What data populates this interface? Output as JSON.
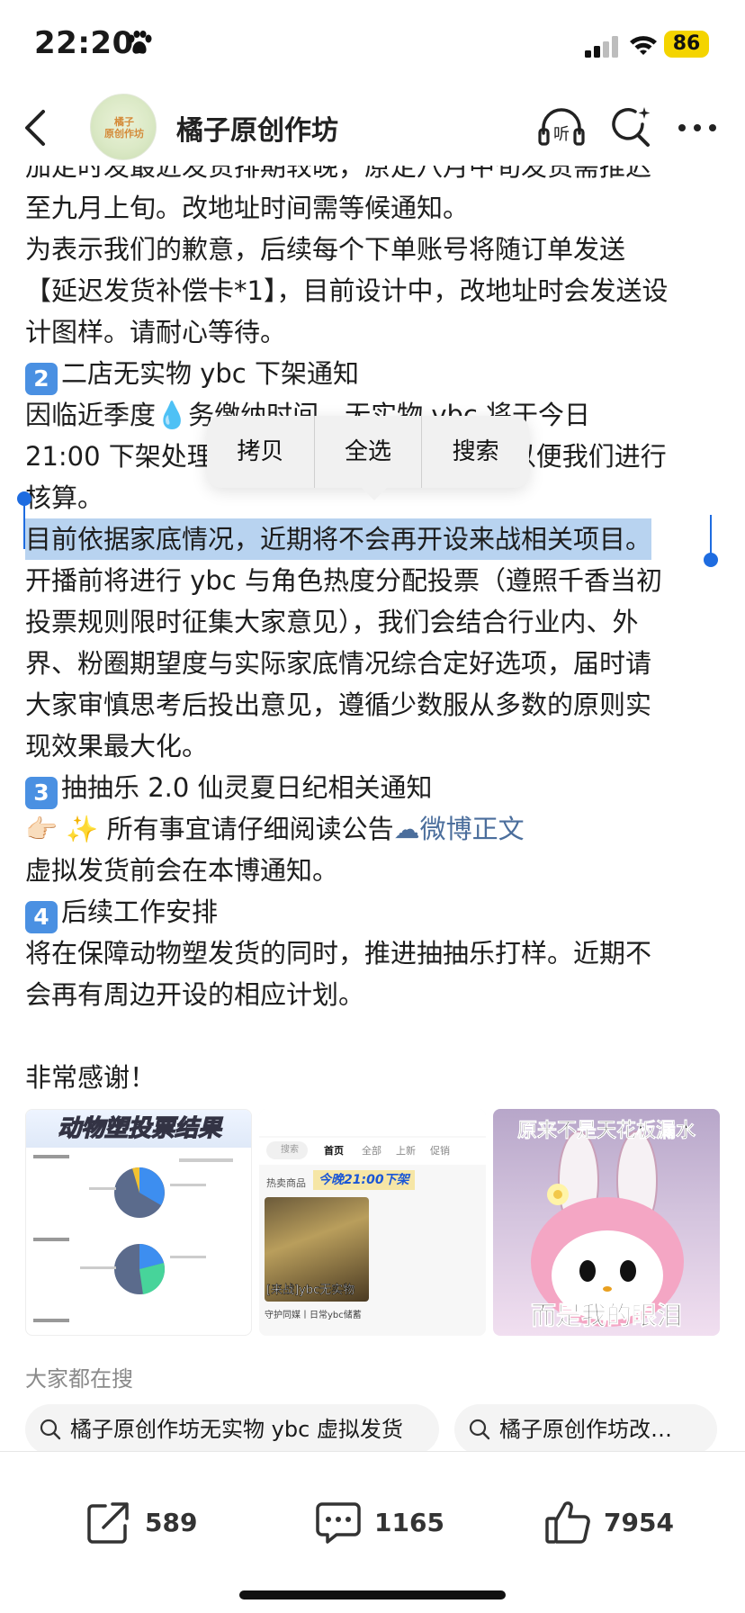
{
  "status_bar": {
    "time": "22:20",
    "battery": "86"
  },
  "nav": {
    "title": "橘子原创作坊",
    "avatar_text_line1": "橘子",
    "avatar_text_line2": "原创作坊"
  },
  "post": {
    "lines": [
      "加定时发最近发货排期较晚，原定八月中旬发货需推迟",
      "至九月上旬。改地址时间需等候通知。",
      "为表示我们的歉意，后续每个下单账号将随订单发送",
      "【延迟发货补偿卡*1】，目前设计中，改地址时会发送设",
      "计图样。请耐心等待。"
    ],
    "section2": {
      "num": "2",
      "title": "二店无实物 ybc 下架通知",
      "line1": "因临近季度💧务缴纳时间、无实物 vbc 将于今日",
      "line2_start": "21:00 下架处理",
      "line2_end": "以便我们进行",
      "line3": "核算。",
      "selected": "目前依据家底情况，近期将不会再开设来战相关项目。",
      "lines_after": [
        "开播前将进行 ybc 与角色热度分配投票（遵照千香当初",
        "投票规则限时征集大家意见），我们会结合行业内、外",
        "界、粉圈期望度与实际家底情况综合定好选项，届时请",
        "大家审慎思考后投出意见，遵循少数服从多数的原则实",
        "现效果最大化。"
      ]
    },
    "section3": {
      "num": "3",
      "title": "抽抽乐 2.0 仙灵夏日纪相关通知",
      "emoji_line_prefix": "👉🏻 ✨ 所有事宜请仔细阅读公告",
      "link_text": "微博正文",
      "line_after": "虚拟发货前会在本博通知。"
    },
    "section4": {
      "num": "4",
      "title": "后续工作安排",
      "lines": [
        "将在保障动物塑发货的同时，推进抽抽乐打样。近期不",
        "会再有周边开设的相应计划。"
      ]
    },
    "thanks": "非常感谢！"
  },
  "context_menu": {
    "copy": "拷贝",
    "select_all": "全选",
    "search": "搜索"
  },
  "images": {
    "img1_title": "动物塑投票结果",
    "img2": {
      "search": "搜索",
      "tabs": [
        "首页",
        "全部",
        "上新",
        "促销"
      ],
      "hot_label": "热卖商品",
      "badge": "今晚21:00下架",
      "card_label": "[来战]ybc无实物",
      "card_sub": "守护同媒丨日常ybc储蓄"
    },
    "img3_top": "原来不是天花板漏水",
    "img3_bottom": "而是我的眼泪"
  },
  "searching": {
    "title": "大家都在搜",
    "chips": [
      "橘子原创作坊无实物 ybc 虚拟发货",
      "橘子原创作坊改…"
    ]
  },
  "actions": {
    "share_count": "589",
    "comment_count": "1165",
    "like_count": "7954"
  },
  "colors": {
    "accent": "#4a90e2",
    "selection": "#b8d3f0",
    "link": "#4b6e9c",
    "battery": "#f4d400"
  }
}
